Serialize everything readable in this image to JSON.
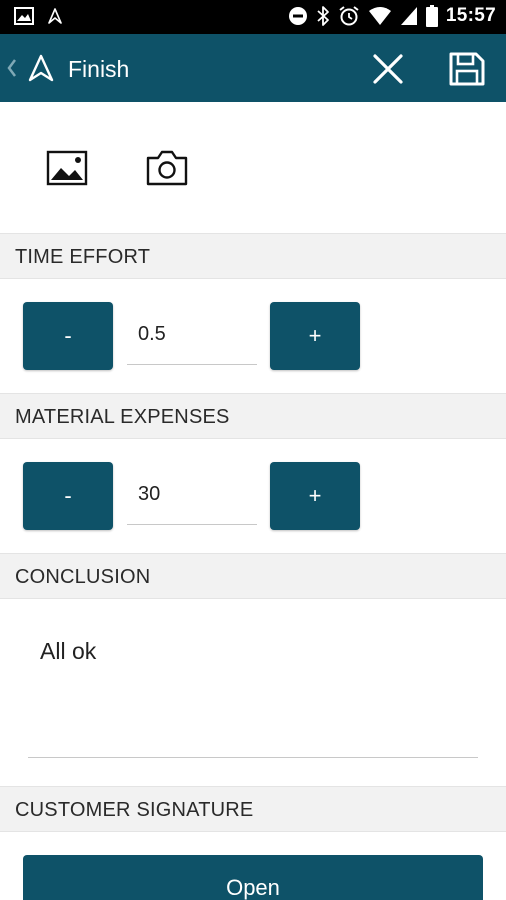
{
  "status_bar": {
    "time": "15:57",
    "icons": [
      "image-notification-icon",
      "app-notification-icon",
      "do-not-disturb-icon",
      "bluetooth-icon",
      "alarm-icon",
      "wifi-icon",
      "cell-signal-icon",
      "battery-icon"
    ]
  },
  "app_bar": {
    "title": "Finish",
    "icons": [
      "back-chevron-icon",
      "app-logo-icon",
      "close-icon",
      "save-icon"
    ]
  },
  "media": {
    "icons": [
      "image-gallery-icon",
      "camera-icon"
    ]
  },
  "time_effort": {
    "header": "TIME EFFORT",
    "minus_label": "-",
    "value": "0.5",
    "plus_label": "+"
  },
  "material_expenses": {
    "header": "MATERIAL EXPENSES",
    "minus_label": "-",
    "value": "30",
    "plus_label": "+"
  },
  "conclusion": {
    "header": "CONCLUSION",
    "value": "All ok"
  },
  "customer_signature": {
    "header": "CUSTOMER SIGNATURE",
    "open_label": "Open"
  },
  "colors": {
    "primary": "#0e5268",
    "status_bar": "#000000",
    "section_bg": "#f2f2f2"
  }
}
